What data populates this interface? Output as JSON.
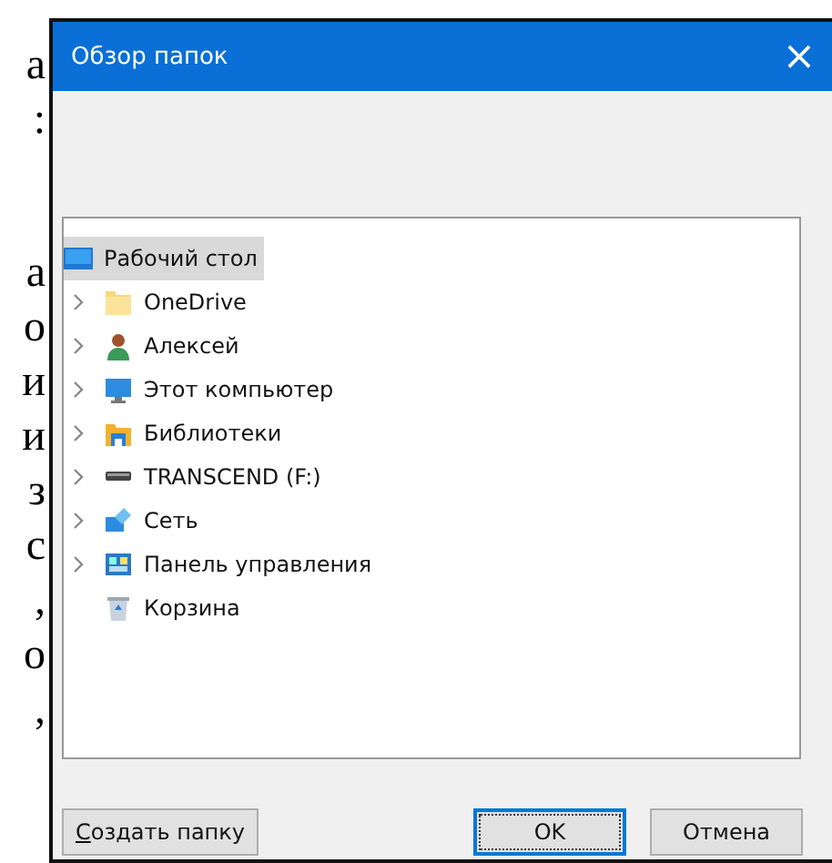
{
  "background_text": {
    "lines": [
      "а",
      ":",
      "а",
      "о",
      "и",
      "и",
      "з",
      "с",
      ",",
      "о",
      ","
    ]
  },
  "window": {
    "title": "Обзор папок",
    "close": "×"
  },
  "tree": {
    "items": [
      {
        "label": "Рабочий стол",
        "kind": "desktop",
        "selected": true,
        "children": [
          {
            "label": "OneDrive",
            "kind": "folder",
            "expandable": true,
            "selected": false
          },
          {
            "label": "Алексей",
            "kind": "user",
            "expandable": true,
            "selected": false
          },
          {
            "label": "Этот компьютер",
            "kind": "computer",
            "expandable": true,
            "selected": false
          },
          {
            "label": "Библиотеки",
            "kind": "library",
            "expandable": true,
            "selected": false
          },
          {
            "label": "TRANSCEND (F:)",
            "kind": "drive",
            "expandable": true,
            "selected": false
          },
          {
            "label": "Сеть",
            "kind": "network",
            "expandable": true,
            "selected": false
          },
          {
            "label": "Панель управления",
            "kind": "control-panel",
            "expandable": true,
            "selected": false
          },
          {
            "label": "Корзина",
            "kind": "recycle-bin",
            "expandable": false,
            "selected": false
          }
        ]
      }
    ]
  },
  "buttons": [
    {
      "label": "Создать папку",
      "access_key_underlined": true,
      "default": false
    },
    {
      "label": "OK",
      "access_key_underlined": false,
      "default": true
    },
    {
      "label": "Отмена",
      "access_key_underlined": false,
      "default": false
    }
  ]
}
